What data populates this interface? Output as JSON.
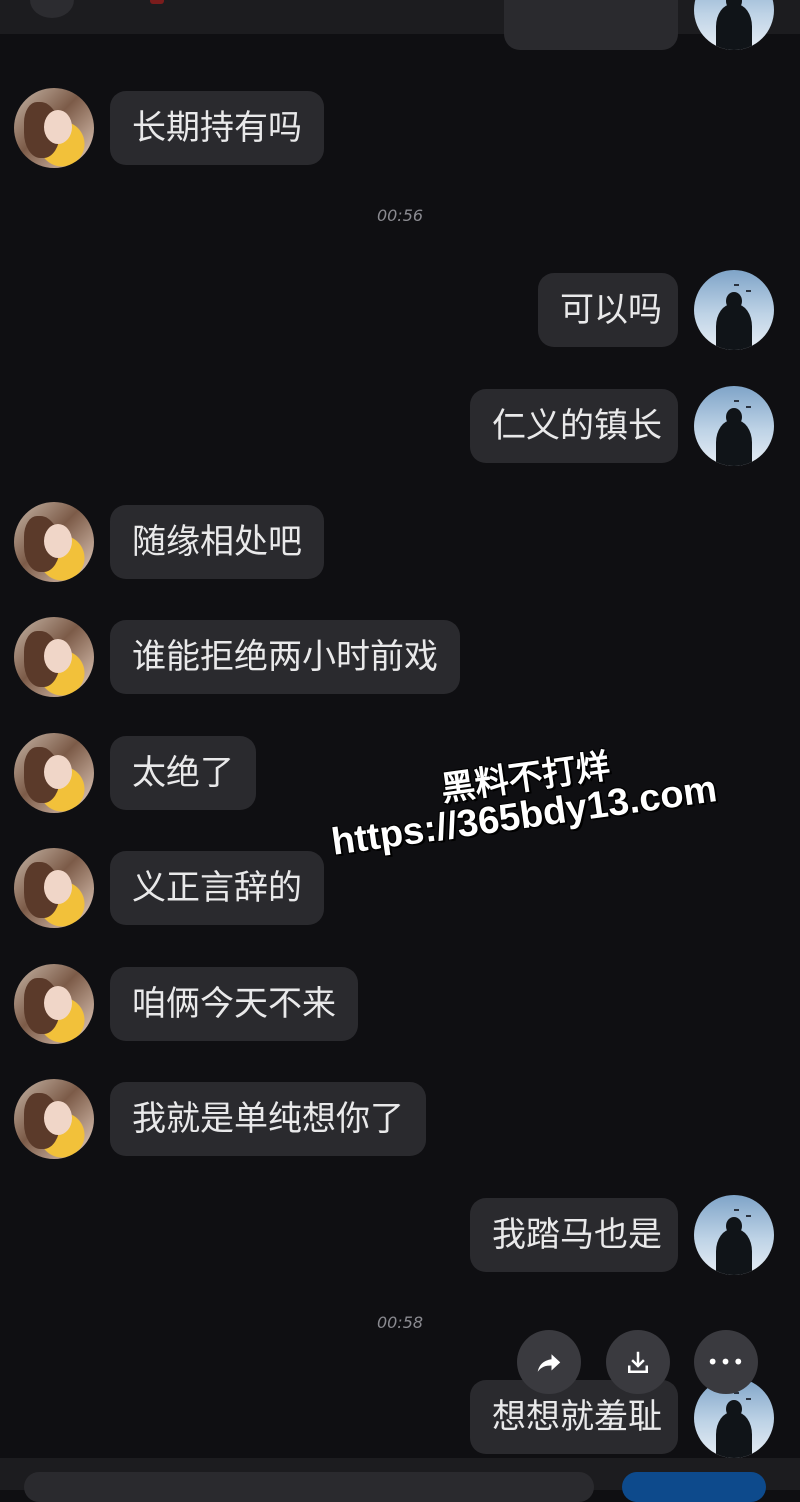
{
  "conversation": {
    "messages": [
      {
        "side": "left",
        "text": "长期持有吗"
      },
      {
        "side": "right",
        "text": "可以吗"
      },
      {
        "side": "right",
        "text": "仁义的镇长"
      },
      {
        "side": "left",
        "text": "随缘相处吧"
      },
      {
        "side": "left",
        "text": "谁能拒绝两小时前戏"
      },
      {
        "side": "left",
        "text": "太绝了"
      },
      {
        "side": "left",
        "text": "义正言辞的"
      },
      {
        "side": "left",
        "text": "咱俩今天不来"
      },
      {
        "side": "left",
        "text": "我就是单纯想你了"
      },
      {
        "side": "right",
        "text": "我踏马也是"
      },
      {
        "side": "right",
        "text": "想想就羞耻"
      }
    ],
    "timestamps": [
      "00:56",
      "00:58"
    ]
  },
  "watermark": {
    "line1": "黑料不打烊",
    "line2": "https://365bdy13.com"
  },
  "actions": {
    "share_icon": "share-icon",
    "save_icon": "download-icon",
    "more_label": "•••"
  },
  "colors": {
    "background": "#0f0f12",
    "bubble": "#2a2a2e",
    "text": "#e9e9ea",
    "timestamp": "#8a8a90"
  }
}
